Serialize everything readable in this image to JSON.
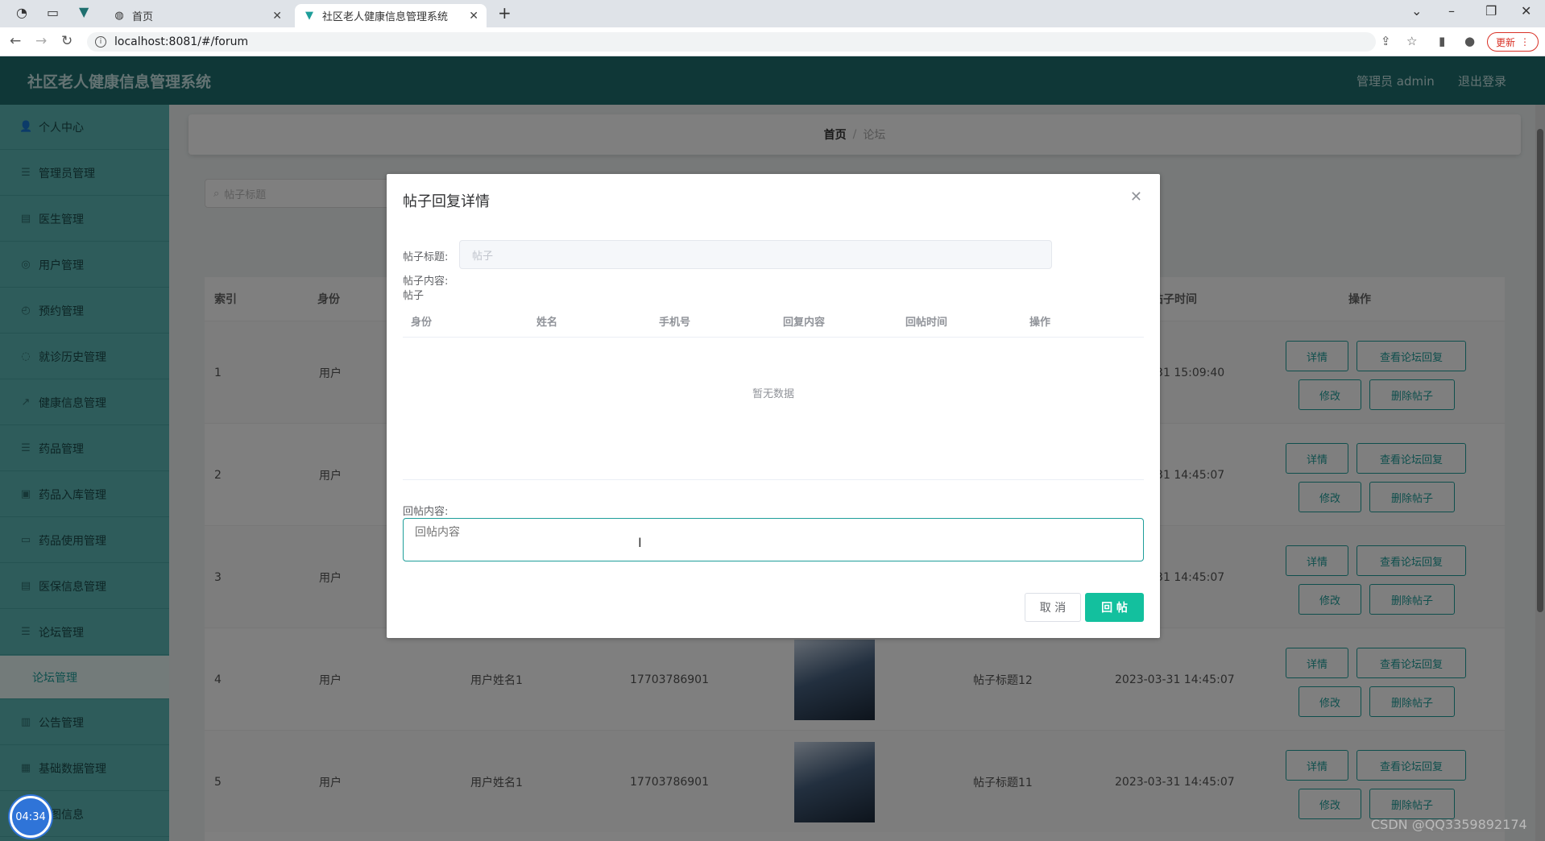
{
  "browser": {
    "tabs": [
      {
        "label": "首页",
        "active": false
      },
      {
        "label": "社区老人健康信息管理系统",
        "active": true
      }
    ],
    "url": "localhost:8081/#/forum",
    "update_label": "更新"
  },
  "header": {
    "title": "社区老人健康信息管理系统",
    "admin": "管理员 admin",
    "logout": "退出登录"
  },
  "sidebar": {
    "items": [
      {
        "label": "个人中心",
        "icon": "user-icon"
      },
      {
        "label": "管理员管理",
        "icon": "list-icon"
      },
      {
        "label": "医生管理",
        "icon": "doctor-icon"
      },
      {
        "label": "用户管理",
        "icon": "users-icon"
      },
      {
        "label": "预约管理",
        "icon": "calendar-icon"
      },
      {
        "label": "就诊历史管理",
        "icon": "history-icon"
      },
      {
        "label": "健康信息管理",
        "icon": "health-icon"
      },
      {
        "label": "药品管理",
        "icon": "medicine-icon"
      },
      {
        "label": "药品入库管理",
        "icon": "inbox-icon"
      },
      {
        "label": "药品使用管理",
        "icon": "usage-icon"
      },
      {
        "label": "医保信息管理",
        "icon": "insurance-icon"
      },
      {
        "label": "论坛管理",
        "icon": "forum-icon"
      },
      {
        "label": "论坛管理",
        "icon": "",
        "sub": true
      },
      {
        "label": "公告管理",
        "icon": "chart-icon"
      },
      {
        "label": "基础数据管理",
        "icon": "grid-icon"
      },
      {
        "label": "播图信息",
        "icon": "image-icon"
      }
    ]
  },
  "main": {
    "breadcrumb": {
      "home": "首页",
      "separator": "/",
      "current": "论坛"
    },
    "search_placeholder": "帖子标题",
    "table": {
      "headers": [
        "索引",
        "身份",
        "帖子时间",
        "操作"
      ],
      "rows": [
        {
          "index": "1",
          "role": "用户",
          "name": "",
          "phone": "",
          "title": "",
          "time": "-31 15:09:40"
        },
        {
          "index": "2",
          "role": "用户",
          "name": "",
          "phone": "",
          "title": "",
          "time": "-31 14:45:07"
        },
        {
          "index": "3",
          "role": "用户",
          "name": "",
          "phone": "",
          "title": "",
          "time": "-31 14:45:07"
        },
        {
          "index": "4",
          "role": "用户",
          "name": "用户姓名1",
          "phone": "17703786901",
          "title": "帖子标题12",
          "time": "2023-03-31 14:45:07"
        },
        {
          "index": "5",
          "role": "用户",
          "name": "用户姓名1",
          "phone": "17703786901",
          "title": "帖子标题11",
          "time": "2023-03-31 14:45:07"
        }
      ],
      "actions": {
        "detail": "详情",
        "view_reply": "查看论坛回复",
        "edit": "修改",
        "delete": "删除帖子"
      }
    }
  },
  "dialog": {
    "title": "帖子回复详情",
    "post_title_label": "帖子标题:",
    "post_title_value": "帖子",
    "post_content_label": "帖子内容:",
    "post_content_value": "帖子",
    "columns": [
      "身份",
      "姓名",
      "手机号",
      "回复内容",
      "回帖时间",
      "操作"
    ],
    "empty_text": "暂无数据",
    "reply_label": "回帖内容:",
    "reply_placeholder": "回帖内容",
    "cancel_label": "取 消",
    "submit_label": "回 帖"
  },
  "overlay_clock": "04:34",
  "watermark": "CSDN @QQ3359892174"
}
